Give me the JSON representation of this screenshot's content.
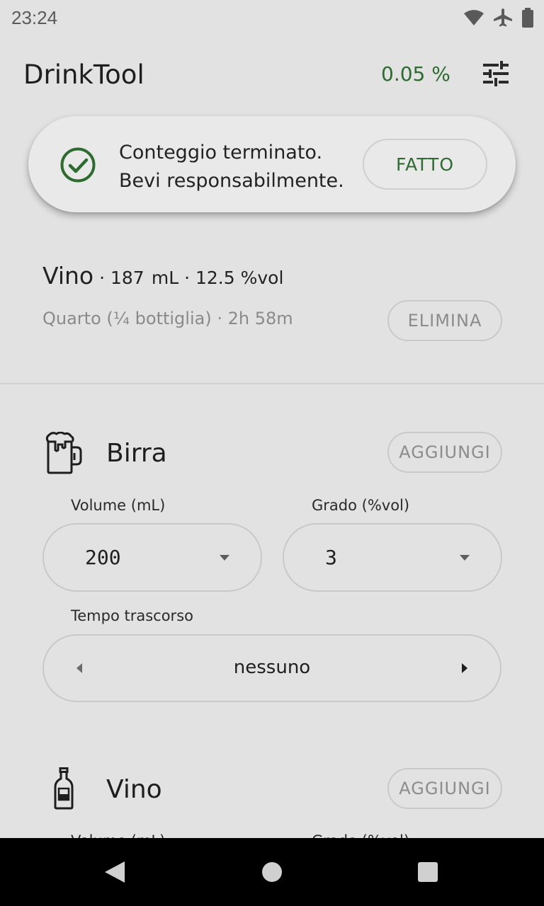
{
  "status_bar": {
    "time": "23:24",
    "icons": [
      "wifi-icon",
      "airplane-icon",
      "battery-icon"
    ]
  },
  "app_bar": {
    "title": "DrinkTool",
    "bac": "0.05 %",
    "settings_icon": "tune-icon"
  },
  "toast": {
    "line1": "Conteggio terminato.",
    "line2": "Bevi responsabilmente.",
    "button": "FATTO",
    "icon": "check-circle-icon"
  },
  "logged_drink": {
    "name": "Vino",
    "sep1": " · ",
    "volume": "187",
    "unit": "mL",
    "sep2": " · ",
    "abv": "12.5 %vol",
    "details": "Quarto (¼ bottiglia) · 2h 58m",
    "delete_label": "ELIMINA"
  },
  "sections": {
    "beer": {
      "icon": "beer-mug-icon",
      "name": "Birra",
      "add_label": "AGGIUNGI",
      "volume_label": "Volume (mL)",
      "volume_value": "200",
      "abv_label": "Grado (%vol)",
      "abv_value": "3",
      "time_label": "Tempo trascorso",
      "time_value": "nessuno"
    },
    "wine": {
      "icon": "wine-bottle-icon",
      "name": "Vino",
      "add_label": "AGGIUNGI",
      "volume_label": "Volume (mL)",
      "abv_label": "Grado (%vol)"
    }
  },
  "colors": {
    "background": "#e2e2e2",
    "accent_green": "#2e6b30",
    "outline": "#c9c9c9"
  }
}
